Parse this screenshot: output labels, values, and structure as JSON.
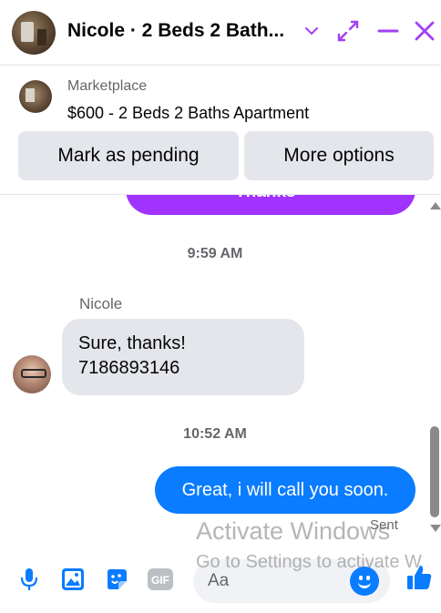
{
  "header": {
    "title": "Nicole · 2 Beds 2 Bath...",
    "colors": {
      "accent": "#a033ff",
      "icon_accent": "#9a3cf5"
    }
  },
  "listing": {
    "source": "Marketplace",
    "title": "$600 - 2 Beds 2 Baths Apartment",
    "buttons": {
      "pending": "Mark as pending",
      "more": "More options"
    }
  },
  "chat": {
    "prev_message": "Thanks",
    "time1": "9:59 AM",
    "sender": "Nicole",
    "recv_line1": "Sure, thanks!",
    "recv_line2": "7186893146",
    "time2": "10:52 AM",
    "sent_message": "Great, i will call you soon.",
    "sent_status": "Sent",
    "colors": {
      "sent_bubble": "#0a7cff",
      "recv_bubble": "#e4e6eb",
      "prev_bubble": "#a033ff"
    }
  },
  "watermark": {
    "line1": "Activate Windows",
    "line2": "Go to Settings to activate W"
  },
  "composer": {
    "placeholder": "Aa",
    "gif_label": "GIF",
    "icons": [
      "microphone-icon",
      "image-icon",
      "sticker-icon",
      "gif-icon",
      "emoji-icon",
      "thumbs-up-icon"
    ],
    "colors": {
      "icon": "#0a7cff"
    }
  }
}
